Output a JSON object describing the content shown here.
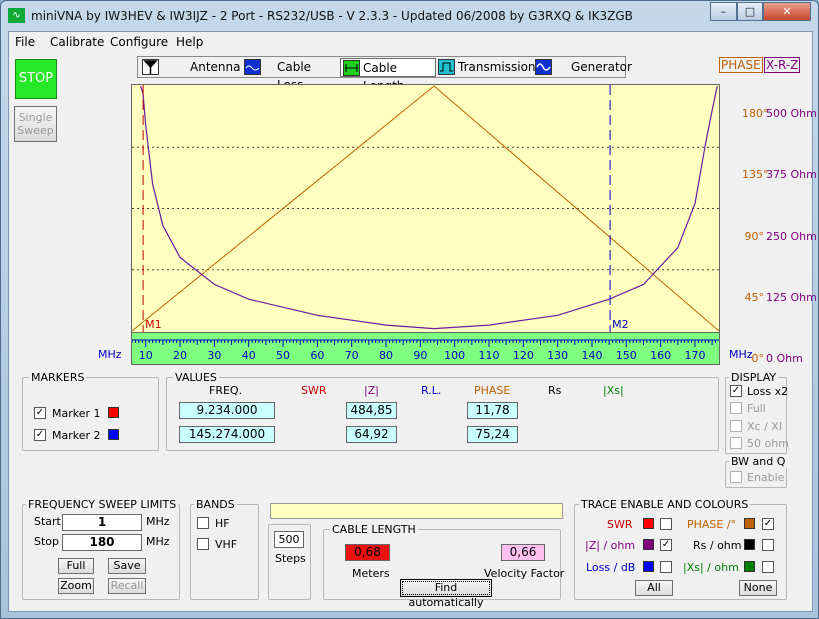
{
  "window": {
    "title": "miniVNA by IW3HEV & IW3IJZ - 2 Port - RS232/USB - V 2.3.3 - Updated 06/2008 by G3RXQ & IK3ZGB",
    "minimize": "–",
    "maximize": "□",
    "close": "✕"
  },
  "menu": [
    "File",
    "Calibrate",
    "Configure",
    "Help"
  ],
  "buttons": {
    "stop": "STOP",
    "single_sweep": [
      "Single",
      "Sweep"
    ]
  },
  "tabs": [
    {
      "label": "Antenna",
      "icon": "antenna-icon"
    },
    {
      "label": "Cable Loss",
      "icon": "cable-loss-icon"
    },
    {
      "label": "Cable Length",
      "icon": "cable-length-icon",
      "selected": true
    },
    {
      "label": "Transmission",
      "icon": "transmission-icon"
    },
    {
      "label": "Generator",
      "icon": "generator-icon"
    }
  ],
  "header_buttons": {
    "phase": "PHASE",
    "xrz": "X-R-Z"
  },
  "chart_data": {
    "type": "line",
    "x_unit": "MHz",
    "xlim": [
      6,
      177
    ],
    "xticks": [
      10,
      20,
      30,
      40,
      50,
      60,
      70,
      80,
      90,
      100,
      110,
      120,
      130,
      140,
      150,
      160,
      170
    ],
    "right_axis": [
      {
        "phase": "180°",
        "ohm": "500 Ohm",
        "value": 180
      },
      {
        "phase": "135°",
        "ohm": "375 Ohm",
        "value": 135
      },
      {
        "phase": "90°",
        "ohm": "250 Ohm",
        "value": 90
      },
      {
        "phase": "45°",
        "ohm": "125 Ohm",
        "value": 45
      },
      {
        "phase": "0°",
        "ohm": "0 Ohm",
        "value": 0
      }
    ],
    "phase_series": {
      "name": "PHASE",
      "color": "#c06000",
      "x": [
        6,
        94,
        177
      ],
      "y": [
        0,
        180,
        0
      ]
    },
    "z_series": {
      "name": "|Z|",
      "color": "#6a1aa0",
      "x": [
        8.5,
        9.2,
        10,
        12,
        15,
        20,
        30,
        40,
        60,
        80,
        94,
        110,
        130,
        145,
        155,
        165,
        170,
        173,
        175,
        176.5
      ],
      "y": [
        500,
        485,
        420,
        300,
        215,
        150,
        95,
        65,
        32,
        12,
        5,
        12,
        32,
        65,
        95,
        170,
        260,
        380,
        450,
        500
      ]
    },
    "markers": [
      {
        "label": "M1",
        "freq": 9.234,
        "color": "#c00000"
      },
      {
        "label": "M2",
        "freq": 145.274,
        "color": "#0000c0"
      }
    ]
  },
  "markers_panel": {
    "title": "MARKERS",
    "items": [
      {
        "label": "Marker 1",
        "checked": true,
        "color": "#ff0000"
      },
      {
        "label": "Marker 2",
        "checked": true,
        "color": "#0000ff"
      }
    ]
  },
  "values_panel": {
    "title": "VALUES",
    "headers": {
      "freq": "FREQ.",
      "swr": "SWR",
      "z": "|Z|",
      "rl": "R.L.",
      "phase": "PHASE",
      "rs": "Rs",
      "xs": "|Xs|"
    },
    "rows": [
      {
        "freq": "9.234.000",
        "z": "484,85",
        "phase": "11,78"
      },
      {
        "freq": "145.274.000",
        "z": "64,92",
        "phase": "75,24"
      }
    ]
  },
  "display_panel": {
    "title": "DISPLAY",
    "items": [
      {
        "label": "Loss x2",
        "checked": true,
        "enabled": true
      },
      {
        "label": "Full",
        "checked": false,
        "enabled": false
      },
      {
        "label": "Xc / Xl",
        "checked": false,
        "enabled": false
      },
      {
        "label": "50 ohm",
        "checked": false,
        "enabled": false
      }
    ]
  },
  "bwq_panel": {
    "title": "BW and Q",
    "enable": "Enable"
  },
  "sweep_panel": {
    "title": "FREQUENCY SWEEP LIMITS",
    "start_label": "Start",
    "start_value": "1",
    "stop_label": "Stop",
    "stop_value": "180",
    "unit": "MHz",
    "buttons": {
      "full": "Full",
      "save": "Save",
      "zoom": "Zoom",
      "recall": "Recall"
    }
  },
  "bands_panel": {
    "title": "BANDS",
    "hf": "HF",
    "vhf": "VHF"
  },
  "steps": {
    "value": "500",
    "label": "Steps"
  },
  "cable_panel": {
    "title": "CABLE LENGTH",
    "meters_value": "0,68",
    "meters_label": "Meters",
    "vf_value": "0,66",
    "vf_label": "Velocity Factor",
    "find_button": "Find automatically"
  },
  "trace_panel": {
    "title": "TRACE ENABLE AND COLOURS",
    "left": [
      {
        "label": "SWR",
        "color": "#ff0000",
        "checked": false,
        "label_color": "#d00000"
      },
      {
        "label": "|Z| / ohm",
        "color": "#800080",
        "checked": true,
        "label_color": "#800080"
      },
      {
        "label": "Loss / dB",
        "color": "#0000ff",
        "checked": false,
        "label_color": "#0000cc"
      }
    ],
    "right": [
      {
        "label": "PHASE /°",
        "color": "#c06000",
        "checked": true,
        "label_color": "#c06000"
      },
      {
        "label": "Rs / ohm",
        "color": "#000000",
        "checked": false,
        "label_color": "#000000"
      },
      {
        "label": "|Xs| / ohm",
        "color": "#008000",
        "checked": false,
        "label_color": "#008000"
      }
    ],
    "all": "All",
    "none": "None"
  }
}
